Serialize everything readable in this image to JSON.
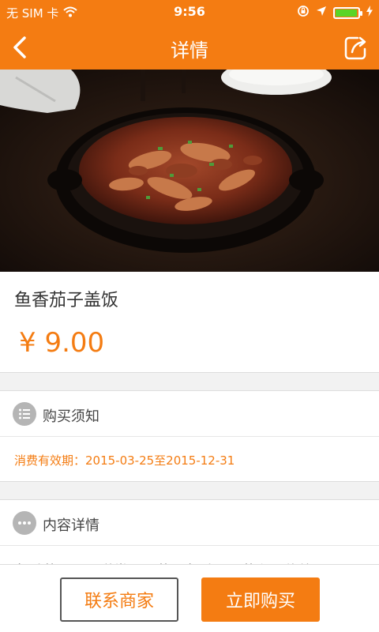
{
  "status_bar": {
    "carrier": "无 SIM 卡",
    "time": "9:56",
    "battery_level": 0.9,
    "icons": [
      "wifi-icon",
      "rotation-lock-icon",
      "location-icon",
      "battery-icon",
      "charging-icon"
    ]
  },
  "nav": {
    "title": "详情",
    "back_icon": "chevron-left-icon",
    "share_icon": "share-icon"
  },
  "product": {
    "image_icon": "dish-photo",
    "name": "鱼香茄子盖饭",
    "price": "¥ 9.00"
  },
  "purchase_notes": {
    "title": "购买须知",
    "icon": "list-icon",
    "validity": "消费有效期：2015-03-25至2015-12-31"
  },
  "content_details": {
    "title": "内容详情",
    "icon": "more-icon",
    "text": "鱼香茄子是一道常见川菜，鱼香是川菜主要传统"
  },
  "actions": {
    "contact_label": "联系商家",
    "buy_label": "立即购买"
  },
  "colors": {
    "accent": "#f47c12",
    "background": "#f2f2f2"
  }
}
